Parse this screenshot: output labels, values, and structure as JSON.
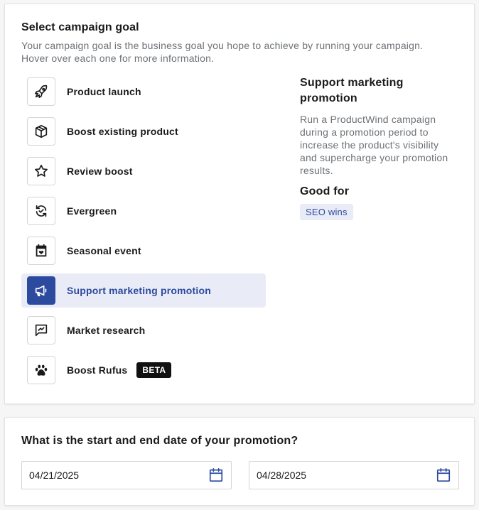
{
  "goal_section": {
    "heading": "Select campaign goal",
    "description": "Your campaign goal is the business goal you hope to achieve by running your campaign. Hover over each one for more information.",
    "goals": [
      {
        "label": "Product launch",
        "icon": "rocket-icon"
      },
      {
        "label": "Boost existing product",
        "icon": "box-icon"
      },
      {
        "label": "Review boost",
        "icon": "star-icon"
      },
      {
        "label": "Evergreen",
        "icon": "refresh-icon"
      },
      {
        "label": "Seasonal event",
        "icon": "calendar-heart-icon"
      },
      {
        "label": "Support marketing promotion",
        "icon": "megaphone-icon",
        "selected": true
      },
      {
        "label": "Market research",
        "icon": "chart-message-icon"
      },
      {
        "label": "Boost Rufus",
        "icon": "paw-icon",
        "badge": "BETA"
      }
    ],
    "detail": {
      "title": "Support marketing promotion",
      "description": "Run a ProductWind campaign during a promotion period to increase the product's visibility and supercharge your promotion results.",
      "good_for_label": "Good for",
      "tags": [
        "SEO wins"
      ]
    }
  },
  "date_section": {
    "question": "What is the start and end date of your promotion?",
    "start_date": "04/21/2025",
    "end_date": "04/28/2025"
  },
  "colors": {
    "accent": "#2c4a9e",
    "selected_bg": "#e9ecf6",
    "muted_text": "#6d7175"
  }
}
